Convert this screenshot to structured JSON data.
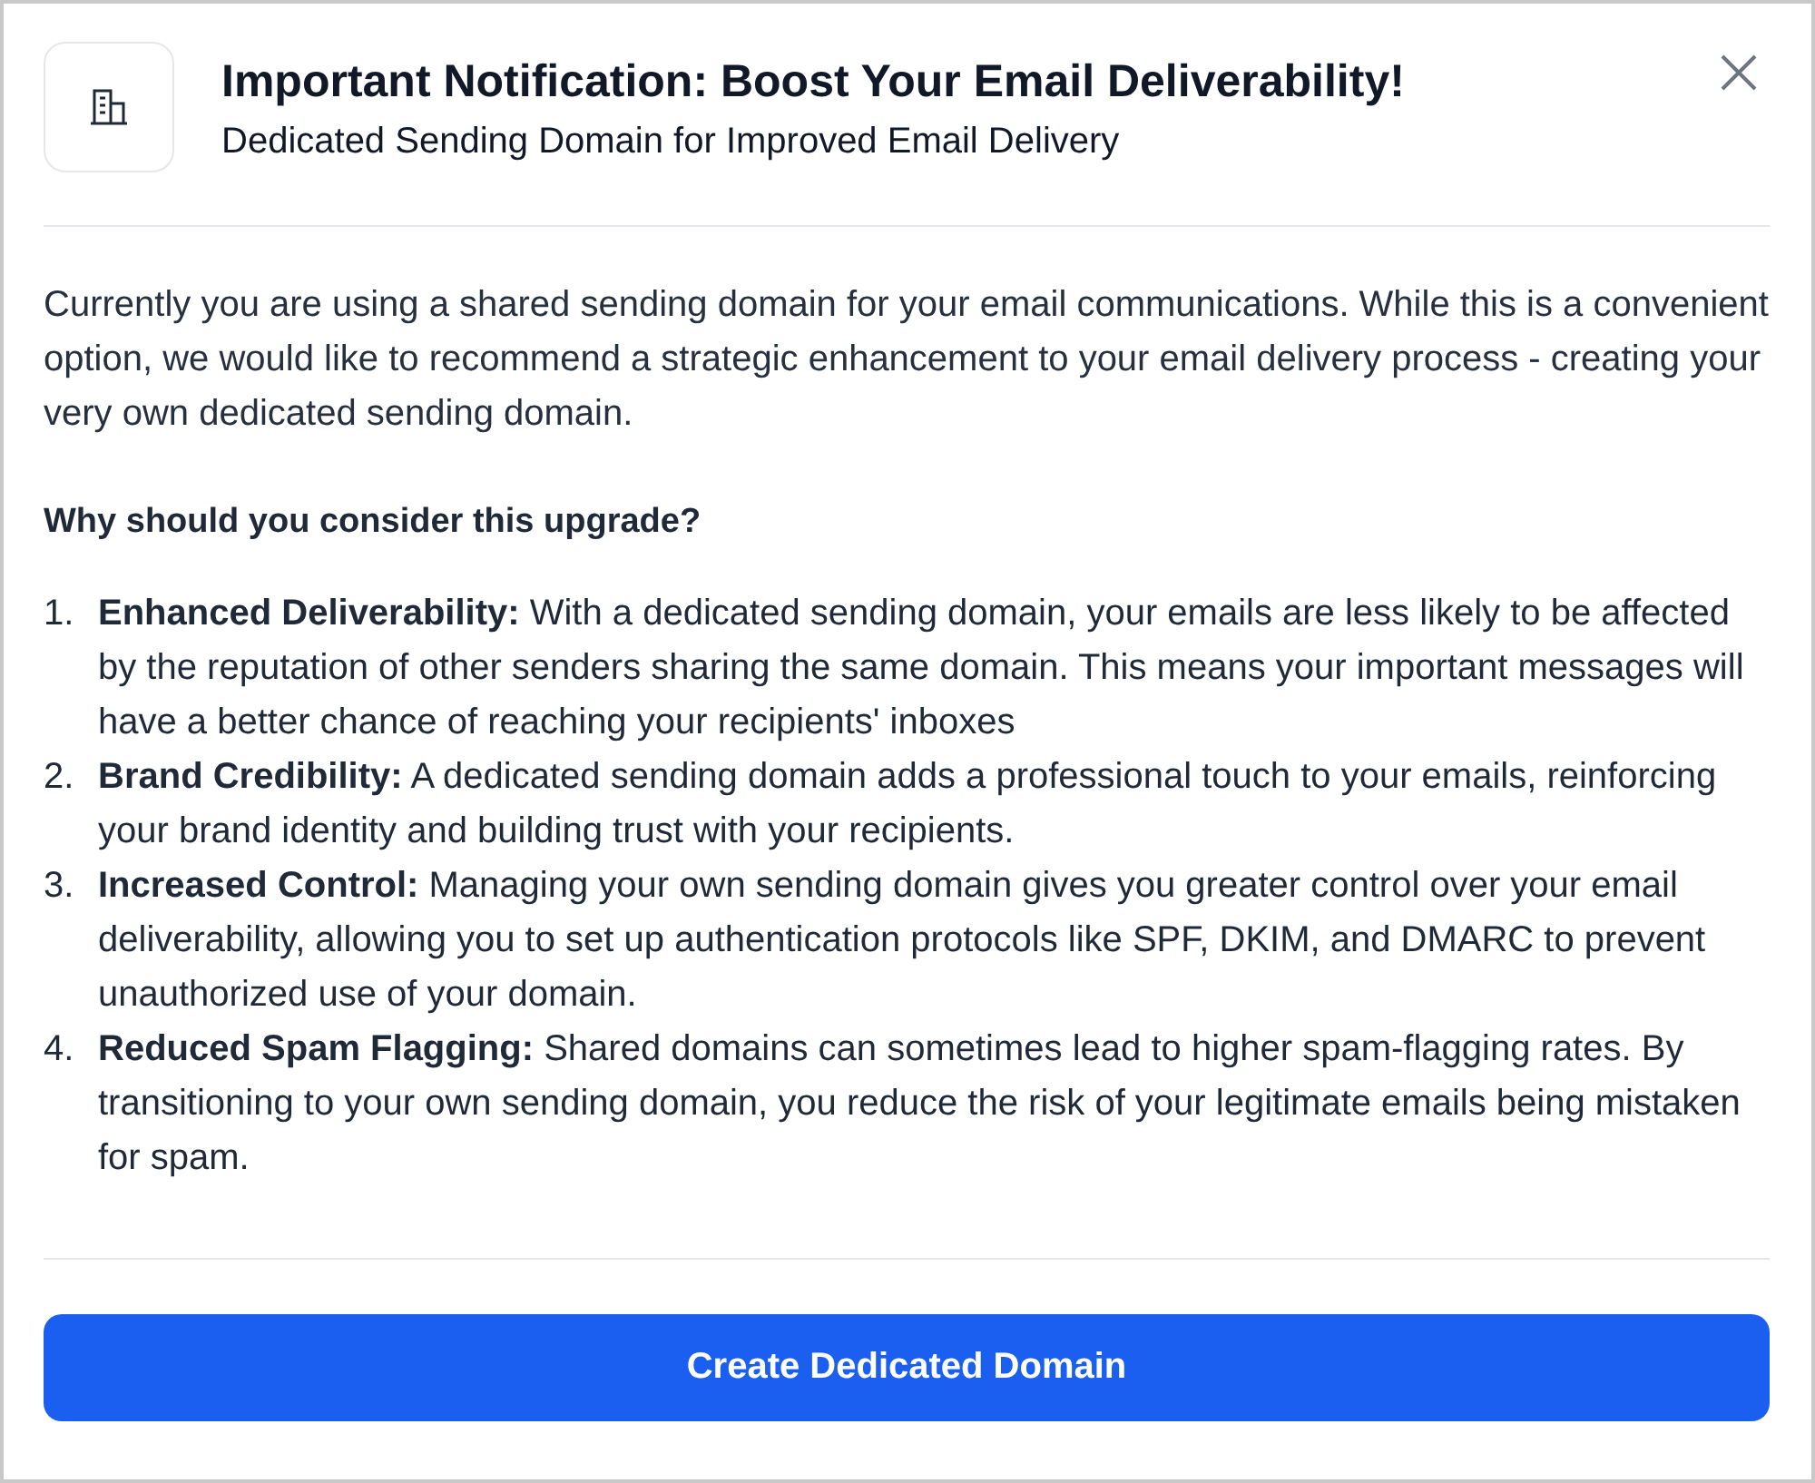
{
  "dialog": {
    "title": "Important Notification: Boost Your Email Deliverability!",
    "subtitle": "Dedicated Sending Domain for Improved Email Delivery"
  },
  "intro": "Currently you are using a shared sending domain for your email communications. While this is a convenient option, we would like to recommend a strategic enhancement to your email delivery process - creating your very own dedicated sending domain.",
  "heading": "Why should you consider this upgrade?",
  "reasons": [
    {
      "number": "1.",
      "text": "**Enhanced Deliverability:** With a dedicated sending domain, your emails are less likely to be affected by the reputation of other senders sharing the same domain. This means your important messages will have a better chance of reaching your recipients' inboxes"
    },
    {
      "number": "2.",
      "text": "**Brand Credibility:** A dedicated sending domain adds a professional touch to your emails, reinforcing your brand identity and building trust with your recipients."
    },
    {
      "number": "3.",
      "text": "**Increased Control:** Managing your own sending domain gives you greater control over your email deliverability, allowing you to set up authentication protocols like SPF, DKIM, and DMARC to prevent unauthorized use of your domain."
    },
    {
      "number": "4.",
      "text": "**Reduced Spam Flagging:** Shared domains can sometimes lead to higher spam-flagging rates. By transitioning to your own sending domain, you reduce the risk of your legitimate emails being mistaken for spam."
    }
  ],
  "button": "Create Dedicated Domain"
}
